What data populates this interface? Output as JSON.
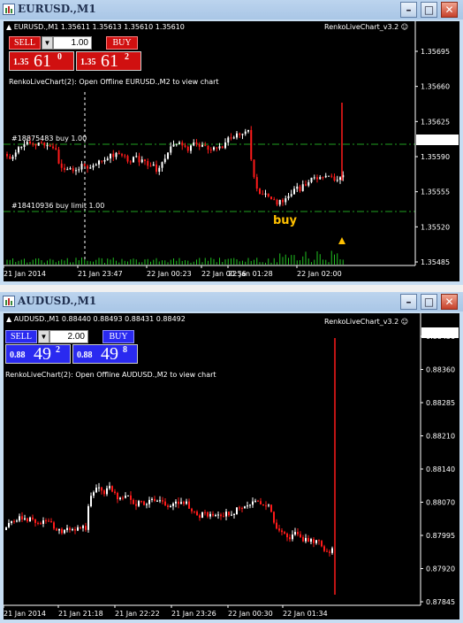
{
  "windows": [
    {
      "title": "EURUSD.,M1",
      "symbol_line": "EURUSD.,M1  1.35611 1.35613 1.35610 1.35610",
      "indicator": "RenkoLiveChart_v3.2",
      "message": "RenkoLiveChart(2): Open Offline EURUSD.,M2 to view chart",
      "sell_label": "SELL",
      "buy_label": "BUY",
      "lot": "1.00",
      "bid_prefix": "1.35",
      "bid_big": "61",
      "bid_sup": "0",
      "ask_prefix": "1.35",
      "ask_big": "61",
      "ask_sup": "2",
      "order1": "#18875483 buy 1.00",
      "order2": "#18410936 buy limit 1.00",
      "buy_arrow_label": "buy",
      "current_price": "1.35610",
      "price_ticks": [
        "1.35695",
        "1.35660",
        "1.35625",
        "1.35590",
        "1.35555",
        "1.35520",
        "1.35485"
      ],
      "time_ticks": [
        "21 Jan 2014",
        "21 Jan 23:47",
        "22 Jan 00:23",
        "22 Jan 00:56",
        "22 Jan 01:28",
        "22 Jan 02:00"
      ],
      "colors": {
        "sell": "#d01010",
        "buy_text": "#ffc000",
        "order_line": "#20a020",
        "candle_up": "#ffffff",
        "candle_down": "#ff1a1a"
      }
    },
    {
      "title": "AUDUSD.,M1",
      "symbol_line": "AUDUSD.,M1  0.88440 0.88493 0.88431 0.88492",
      "indicator": "RenkoLiveChart_v3.2",
      "message": "RenkoLiveChart(2): Open Offline AUDUSD.,M2 to view chart",
      "sell_label": "SELL",
      "buy_label": "BUY",
      "lot": "2.00",
      "bid_prefix": "0.88",
      "bid_big": "49",
      "bid_sup": "2",
      "ask_prefix": "0.88",
      "ask_big": "49",
      "ask_sup": "8",
      "current_price": "0.88492",
      "price_ticks": [
        "0.88436",
        "0.88360",
        "0.88285",
        "0.88210",
        "0.88140",
        "0.88070",
        "0.87995",
        "0.87920",
        "0.87845"
      ],
      "time_ticks": [
        "21 Jan 2014",
        "21 Jan 21:18",
        "21 Jan 22:22",
        "21 Jan 23:26",
        "22 Jan 00:30",
        "22 Jan 01:34"
      ],
      "colors": {
        "panel": "#2a2af0",
        "candle_up": "#ffffff",
        "candle_down": "#ff1a1a"
      }
    }
  ]
}
